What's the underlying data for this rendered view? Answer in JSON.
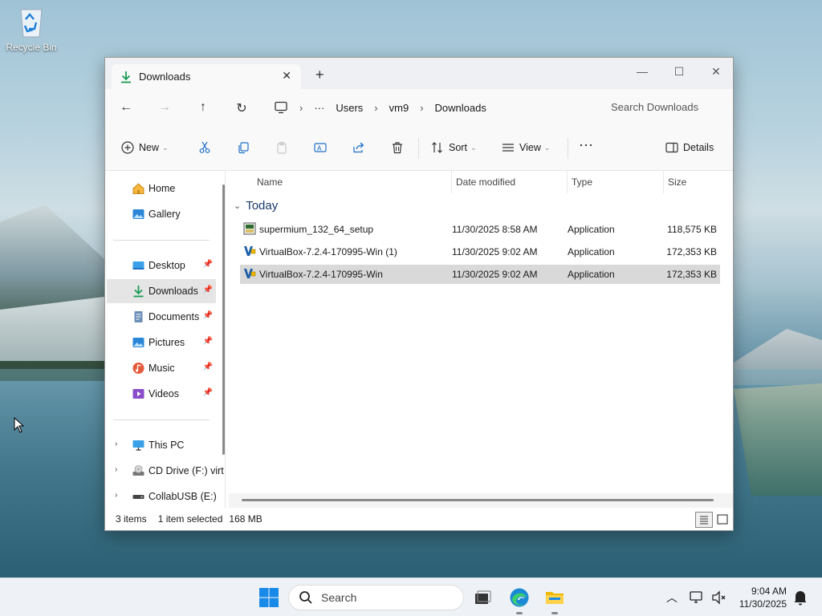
{
  "desktop": {
    "recycle_bin_label": "Recycle Bin"
  },
  "window": {
    "tab_title": "Downloads",
    "breadcrumb": [
      "Users",
      "vm9",
      "Downloads"
    ],
    "search_placeholder": "Search Downloads",
    "commands": {
      "new": "New",
      "sort": "Sort",
      "view": "View",
      "details": "Details"
    },
    "sidebar": {
      "home": "Home",
      "gallery": "Gallery",
      "desktop": "Desktop",
      "downloads": "Downloads",
      "documents": "Documents",
      "pictures": "Pictures",
      "music": "Music",
      "videos": "Videos",
      "this_pc": "This PC",
      "cd_drive": "CD Drive (F:) virt",
      "collabusb": "CollabUSB (E:)"
    },
    "columns": {
      "name": "Name",
      "date": "Date modified",
      "type": "Type",
      "size": "Size"
    },
    "group_label": "Today",
    "files": [
      {
        "name": "supermium_132_64_setup",
        "date": "11/30/2025 8:58 AM",
        "type": "Application",
        "size": "118,575 KB",
        "icon": "installer-icon"
      },
      {
        "name": "VirtualBox-7.2.4-170995-Win (1)",
        "date": "11/30/2025 9:02 AM",
        "type": "Application",
        "size": "172,353 KB",
        "icon": "virtualbox-icon"
      },
      {
        "name": "VirtualBox-7.2.4-170995-Win",
        "date": "11/30/2025 9:02 AM",
        "type": "Application",
        "size": "172,353 KB",
        "icon": "virtualbox-icon"
      }
    ],
    "status": {
      "items": "3 items",
      "selected": "1 item selected",
      "size": "168 MB"
    }
  },
  "taskbar": {
    "search_placeholder": "Search",
    "time": "9:04 AM",
    "date": "11/30/2025"
  },
  "colors": {
    "accent": "#0067c0",
    "selection": "#d9d9d9",
    "taskbar": "#eef1f6"
  }
}
